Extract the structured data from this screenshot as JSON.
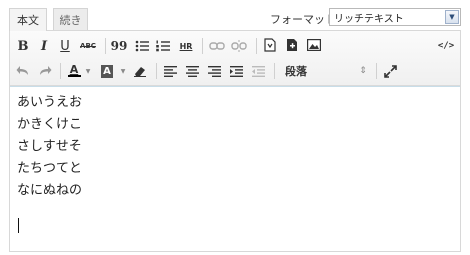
{
  "tabs": [
    {
      "label": "本文",
      "active": true
    },
    {
      "label": "続き",
      "active": false
    }
  ],
  "format": {
    "label": "フォーマット:",
    "selected": "リッチテキスト"
  },
  "toolbar": {
    "bold": "B",
    "italic": "I",
    "underline": "U",
    "strike": "ABC",
    "quote": "99",
    "hr": "HR",
    "source": "</>",
    "font_color": "A",
    "bg_color": "A",
    "paragraph": "段落"
  },
  "content": {
    "lines": [
      "あいうえお",
      "かきくけこ",
      "さしすせそ",
      "たちつてと",
      "なにぬねの"
    ]
  },
  "colors": {
    "accent": "#c8dde8",
    "font_color_bar": "#000000"
  }
}
